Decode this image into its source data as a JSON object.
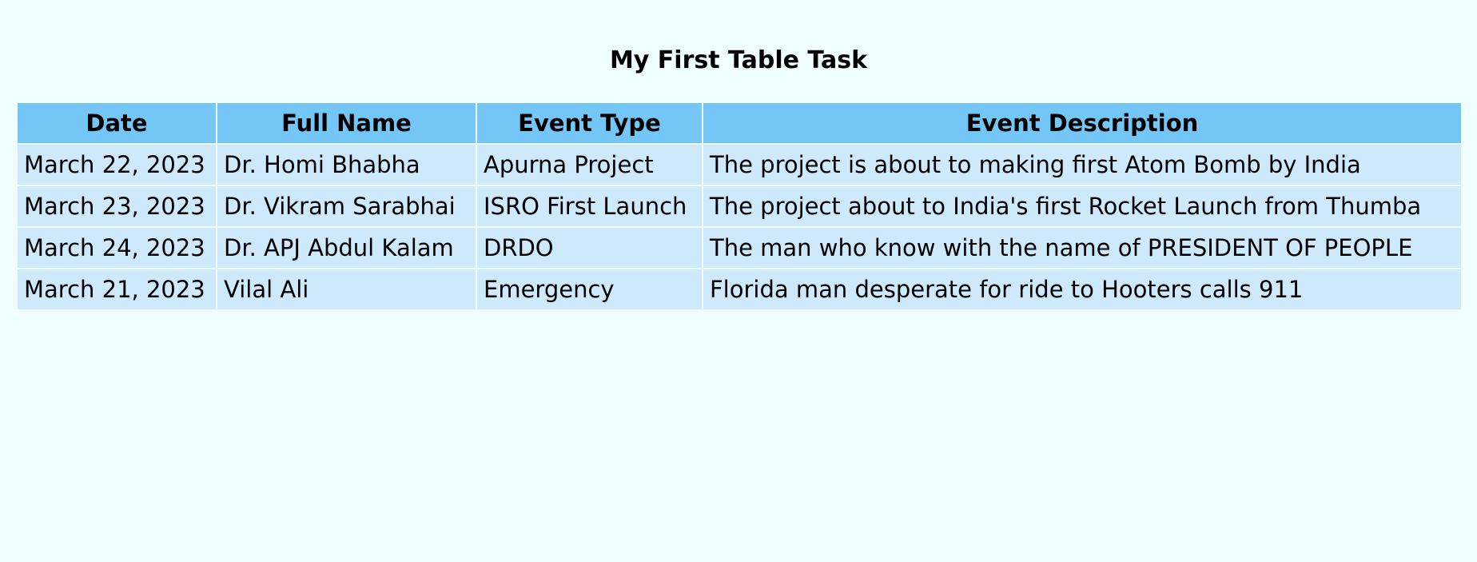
{
  "page": {
    "title": "My First Table Task"
  },
  "colors": {
    "background": "#f0ffff",
    "header_bg": "#74c6f7",
    "row_bg": "#cde9fb"
  },
  "table": {
    "headers": [
      "Date",
      "Full Name",
      "Event Type",
      "Event Description"
    ],
    "rows": [
      [
        "March 22, 2023",
        "Dr. Homi Bhabha",
        "Apurna Project",
        "The project is about to making first Atom Bomb by India"
      ],
      [
        "March 23, 2023",
        "Dr. Vikram Sarabhai",
        "ISRO First Launch",
        "The project about to India's first Rocket Launch from Thumba"
      ],
      [
        "March 24, 2023",
        "Dr. APJ Abdul Kalam",
        "DRDO",
        "The man who know with the name of PRESIDENT OF PEOPLE"
      ],
      [
        "March 21, 2023",
        "Vilal Ali",
        "Emergency",
        "Florida man desperate for ride to Hooters calls 911"
      ]
    ]
  }
}
